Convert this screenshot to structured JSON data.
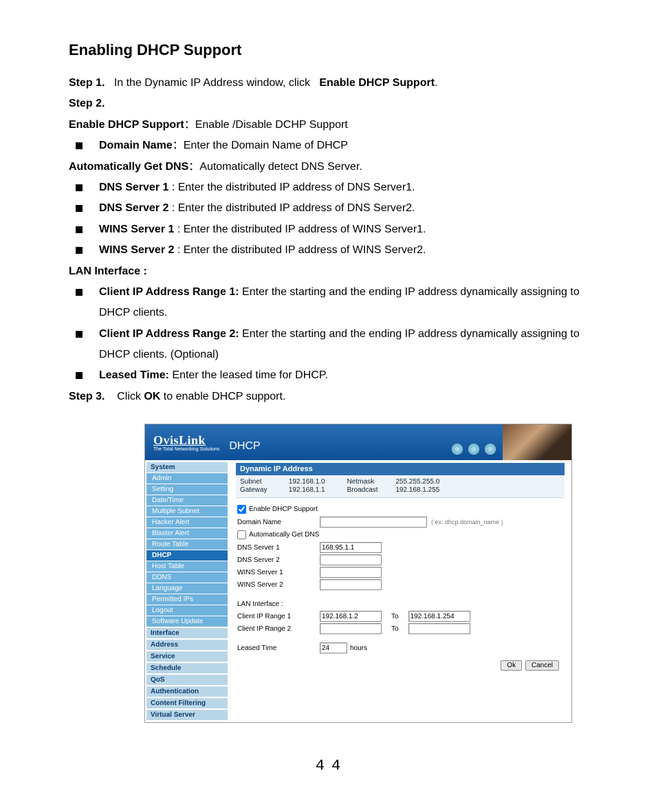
{
  "doc": {
    "title": "Enabling DHCP Support",
    "step1_label": "Step 1.",
    "step1_text_a": "In the Dynamic IP Address window, click ",
    "step1_text_b": "Enable DHCP Support",
    "step1_text_c": ".",
    "step2_label": "Step 2.",
    "line_enable_a": "Enable DHCP Support",
    "line_enable_b": "：Enable /Disable DCHP Support",
    "bullets1": [
      {
        "b": "Domain Name",
        "t": "：Enter the Domain Name of DHCP"
      }
    ],
    "line_autodns_a": "Automatically Get DNS",
    "line_autodns_b": "：Automatically detect DNS Server.",
    "bullets2": [
      {
        "b": "DNS Server 1",
        "t": " : Enter the distributed IP address of DNS Server1."
      },
      {
        "b": "DNS Server 2",
        "t": " : Enter the distributed IP address of DNS Server2."
      },
      {
        "b": "WINS Server 1",
        "t": " : Enter the distributed IP address of WINS Server1."
      },
      {
        "b": "WINS Server 2",
        "t": " : Enter the distributed IP address of WINS Server2."
      }
    ],
    "lan_label": "LAN Interface :",
    "bullets3": [
      {
        "b": "Client IP Address Range 1:",
        "t": " Enter the starting and the ending IP address dynamically assigning to DHCP clients."
      },
      {
        "b": "Client IP Address Range 2:",
        "t": " Enter the starting and the ending IP address dynamically assigning to DHCP clients. (Optional)"
      },
      {
        "b": "Leased Time:",
        "t": " Enter the leased time for DHCP."
      }
    ],
    "step3_label": "Step 3.",
    "step3_a": "Click ",
    "step3_b": "OK",
    "step3_c": " to enable DHCP support.",
    "page_number": "44"
  },
  "ui": {
    "brand": "OvisLink",
    "tagline": "The Total Networking Solutions",
    "page_title": "DHCP",
    "sidebar": {
      "sections": [
        {
          "label": "System",
          "items": [
            "Admin",
            "Setting",
            "Date/Time",
            "Multiple Subnet",
            "Hacker Alert",
            "Blaster Alert",
            "Route Table",
            "DHCP",
            "Host Table",
            "DDNS",
            "Language",
            "Permitted IPs",
            "Logout",
            "Software Update"
          ],
          "active": "DHCP"
        },
        {
          "label": "Interface",
          "items": []
        },
        {
          "label": "Address",
          "items": []
        },
        {
          "label": "Service",
          "items": []
        },
        {
          "label": "Schedule",
          "items": []
        },
        {
          "label": "QoS",
          "items": []
        },
        {
          "label": "Authentication",
          "items": []
        },
        {
          "label": "Content Filtering",
          "items": []
        },
        {
          "label": "Virtual Server",
          "items": []
        }
      ]
    },
    "panel_header": "Dynamic IP Address",
    "info": {
      "subnet_k": "Subnet",
      "subnet_v": "192.168.1.0",
      "netmask_k": "Netmask",
      "netmask_v": "255.255.255.0",
      "gateway_k": "Gateway",
      "gateway_v": "192.168.1.1",
      "broadcast_k": "Broadcast",
      "broadcast_v": "192.168.1.255"
    },
    "form": {
      "enable_label": "Enable DHCP Support",
      "enable_checked": true,
      "domain_label": "Domain Name",
      "domain_value": "",
      "domain_hint": "( ex: dhcp.domain_name )",
      "autodns_label": "Automatically Get DNS",
      "autodns_checked": false,
      "dns1_label": "DNS Server 1",
      "dns1_value": "168.95.1.1",
      "dns2_label": "DNS Server 2",
      "dns2_value": "",
      "wins1_label": "WINS Server 1",
      "wins1_value": "",
      "wins2_label": "WINS Server 2",
      "wins2_value": "",
      "lan_label": "LAN Interface :",
      "range1_label": "Client IP Range 1",
      "range1_from": "192.168.1.2",
      "to_label": "To",
      "range1_to": "192.168.1.254",
      "range2_label": "Client IP Range 2",
      "range2_from": "",
      "range2_to": "",
      "leased_label": "Leased Time",
      "leased_value": "24",
      "leased_unit": "hours",
      "ok": "Ok",
      "cancel": "Cancel"
    }
  }
}
